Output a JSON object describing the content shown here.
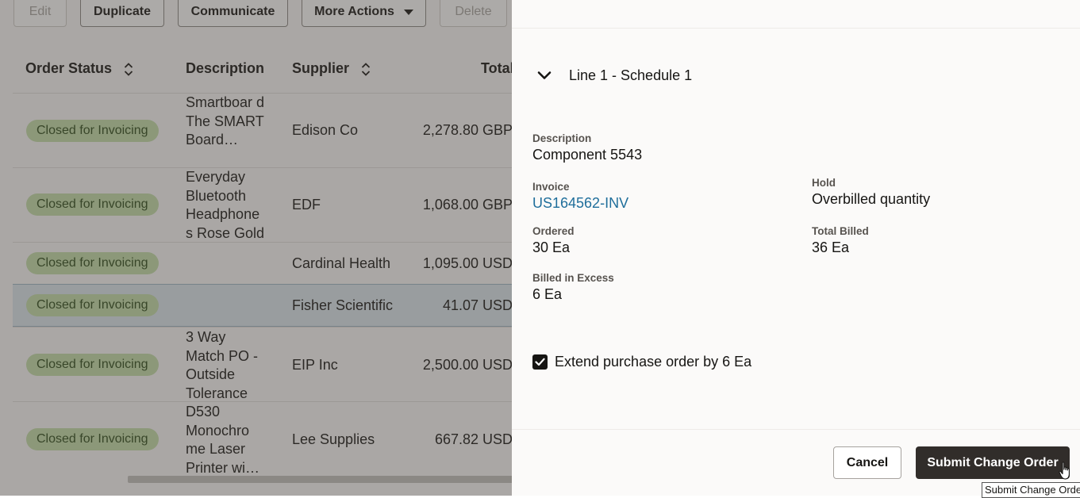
{
  "toolbar": {
    "edit": "Edit",
    "duplicate": "Duplicate",
    "communicate": "Communicate",
    "more_actions": "More Actions",
    "delete": "Delete"
  },
  "table": {
    "headers": {
      "order_status": "Order Status",
      "description": "Description",
      "supplier": "Supplier",
      "total": "Total"
    },
    "rows": [
      {
        "status": "Closed for Invoicing",
        "description": "Smartboar d The SMART Board…",
        "supplier": "Edison Co",
        "total": "2,278.80 GBP",
        "selected": false
      },
      {
        "status": "Closed for Invoicing",
        "description": "Everyday Bluetooth Headphone s Rose Gold",
        "supplier": "EDF",
        "total": "1,068.00 GBP",
        "selected": false
      },
      {
        "status": "Closed for Invoicing",
        "description": "",
        "supplier": "Cardinal Health",
        "total": "1,095.00 USD",
        "selected": false
      },
      {
        "status": "Closed for Invoicing",
        "description": "",
        "supplier": "Fisher Scientific",
        "total": "41.07 USD",
        "selected": true
      },
      {
        "status": "Closed for Invoicing",
        "description": "3 Way Match PO - Outside Tolerance",
        "supplier": "EIP Inc",
        "total": "2,500.00 USD",
        "selected": false
      },
      {
        "status": "Closed for Invoicing",
        "description": "D530 Monochro me Laser Printer wi…",
        "supplier": "Lee Supplies",
        "total": "667.82 USD",
        "selected": false
      }
    ]
  },
  "drawer": {
    "section_title": "Line 1 - Schedule 1",
    "fields": {
      "description_label": "Description",
      "description_value": "Component 5543",
      "invoice_label": "Invoice",
      "invoice_value": "US164562-INV",
      "hold_label": "Hold",
      "hold_value": "Overbilled quantity",
      "ordered_label": "Ordered",
      "ordered_value": "30 Ea",
      "total_billed_label": "Total Billed",
      "total_billed_value": "36 Ea",
      "billed_excess_label": "Billed in Excess",
      "billed_excess_value": "6 Ea"
    },
    "extend_checkbox": {
      "label": "Extend purchase order by 6 Ea",
      "checked": true
    },
    "cancel_label": "Cancel",
    "submit_label": "Submit Change Order",
    "tooltip": "Submit Change Order"
  },
  "colors": {
    "badge_bg": "#c5deaa",
    "primary_button": "#312d2a",
    "link": "#1f6e9b",
    "selected_row": "#dde8ef"
  }
}
